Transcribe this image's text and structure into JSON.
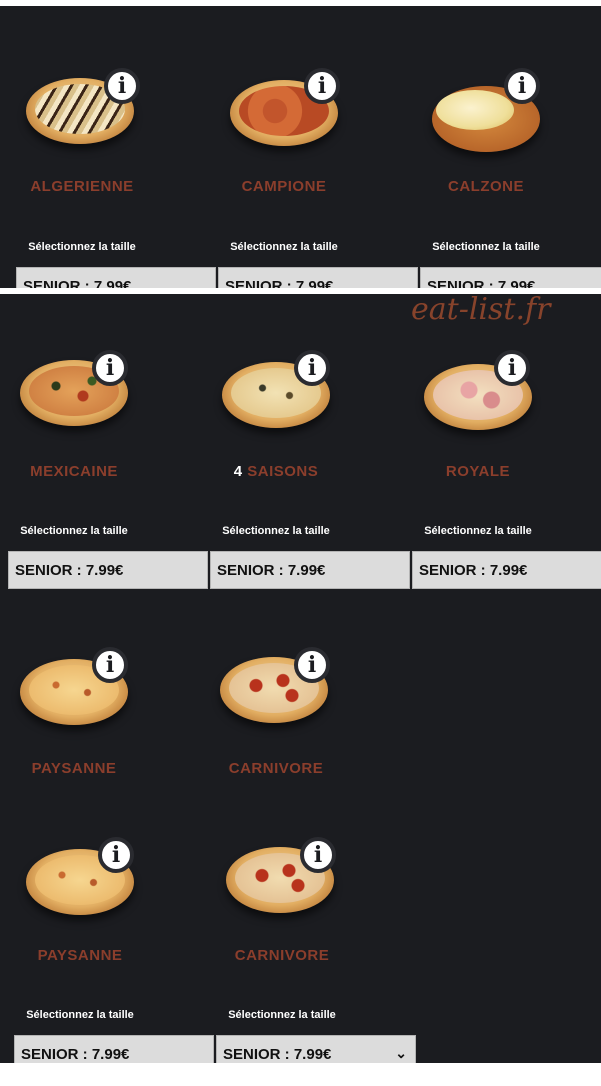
{
  "watermark": "eat-list.fr",
  "panel1": {
    "items": [
      {
        "name": "ALGERIENNE",
        "select": "Sélectionnez la taille",
        "size": "SENIOR : 7.99€"
      },
      {
        "name": "CAMPIONE",
        "select": "Sélectionnez la taille",
        "size": "SENIOR : 7.99€"
      },
      {
        "name": "CALZONE",
        "select": "Sélectionnez la taille",
        "size": "SENIOR : 7.99€"
      }
    ]
  },
  "panel2": {
    "items": [
      {
        "name": "MEXICAINE",
        "select": "Sélectionnez la taille",
        "size": "SENIOR : 7.99€"
      },
      {
        "name_num": "4",
        "name": "SAISONS",
        "select": "Sélectionnez la taille",
        "size": "SENIOR : 7.99€"
      },
      {
        "name": "ROYALE",
        "select": "Sélectionnez la taille",
        "size": "SENIOR : 7.99€"
      }
    ]
  },
  "panel3": {
    "items": [
      {
        "name": "PAYSANNE"
      },
      {
        "name": "CARNIVORE"
      }
    ]
  },
  "panel4": {
    "items": [
      {
        "name": "PAYSANNE",
        "select": "Sélectionnez la taille",
        "size": "SENIOR : 7.99€"
      },
      {
        "name": "CARNIVORE",
        "select": "Sélectionnez la taille",
        "size": "SENIOR : 7.99€"
      }
    ]
  },
  "icons": {
    "info": "i",
    "dropdown": "⌄"
  },
  "colors": {
    "background": "#1b1c20",
    "name": "#8b3e2c",
    "size_box": "#dcdcdc"
  }
}
